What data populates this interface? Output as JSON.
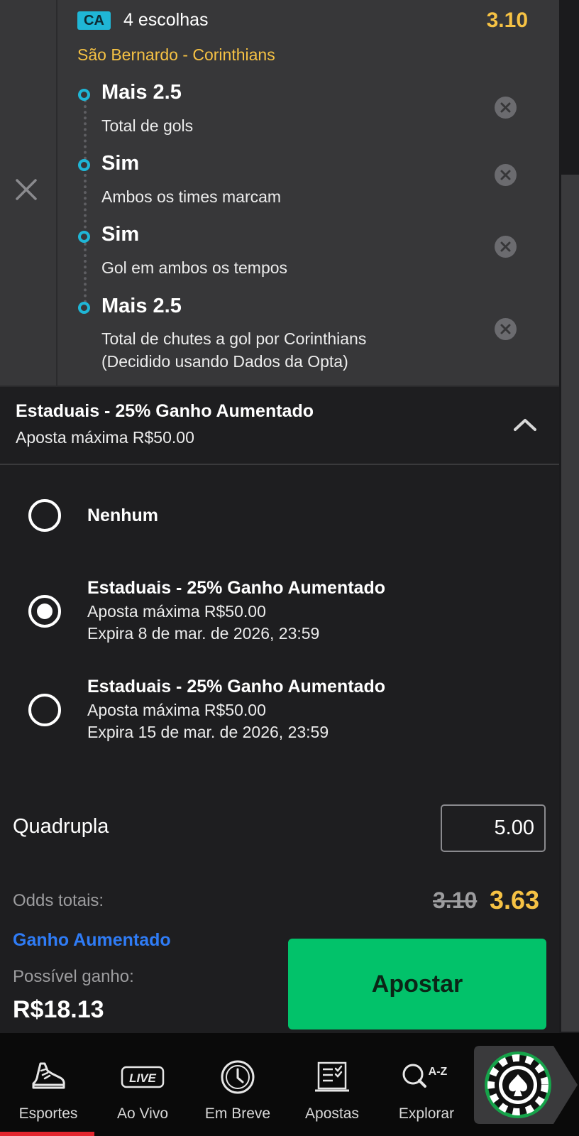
{
  "slip": {
    "badge": "CA",
    "picks_count": "4 escolhas",
    "odds": "3.10",
    "match": "São Bernardo - Corinthians",
    "selections": [
      {
        "title": "Mais 2.5",
        "market": "Total de gols"
      },
      {
        "title": "Sim",
        "market": "Ambos os times marcam"
      },
      {
        "title": "Sim",
        "market": "Gol em ambos os tempos"
      },
      {
        "title": "Mais 2.5",
        "market": "Total de chutes a gol por Corinthians",
        "market_line2": "(Decidido usando Dados da Opta)"
      }
    ]
  },
  "promo": {
    "title": "Estaduais - 25% Ganho Aumentado",
    "subtitle": "Aposta máxima R$50.00"
  },
  "options": [
    {
      "title": "Nenhum",
      "selected": false
    },
    {
      "title": "Estaduais - 25% Ganho Aumentado",
      "line1": "Aposta máxima R$50.00",
      "line2": "Expira 8 de mar. de 2026, 23:59",
      "selected": true
    },
    {
      "title": "Estaduais - 25% Ganho Aumentado",
      "line1": "Aposta máxima R$50.00",
      "line2": "Expira 15 de mar. de 2026, 23:59",
      "selected": false
    }
  ],
  "stake": {
    "bet_type": "Quadrupla",
    "amount": "5.00"
  },
  "totals": {
    "odds_label": "Odds totais:",
    "odds_old": "3.10",
    "odds_new": "3.63",
    "boost_link": "Ganho Aumentado",
    "payout_label": "Possível ganho:",
    "payout_value": "R$18.13"
  },
  "place_bet_label": "Apostar",
  "nav": {
    "items": [
      {
        "label": "Esportes",
        "icon": "sneaker-icon",
        "active": true
      },
      {
        "label": "Ao Vivo",
        "icon": "live-icon",
        "active": false
      },
      {
        "label": "Em Breve",
        "icon": "clock-icon",
        "active": false
      },
      {
        "label": "Apostas",
        "icon": "betslip-icon",
        "active": false
      },
      {
        "label": "Explorar",
        "icon": "search-az-icon",
        "active": false
      }
    ],
    "live_badge": "LIVE",
    "az_text": "A-Z"
  },
  "colors": {
    "accent_yellow": "#f6c244",
    "accent_cyan": "#1fb6d6",
    "cta_green": "#02c26a",
    "link_blue": "#2f7cf6",
    "active_red": "#e3262e"
  }
}
